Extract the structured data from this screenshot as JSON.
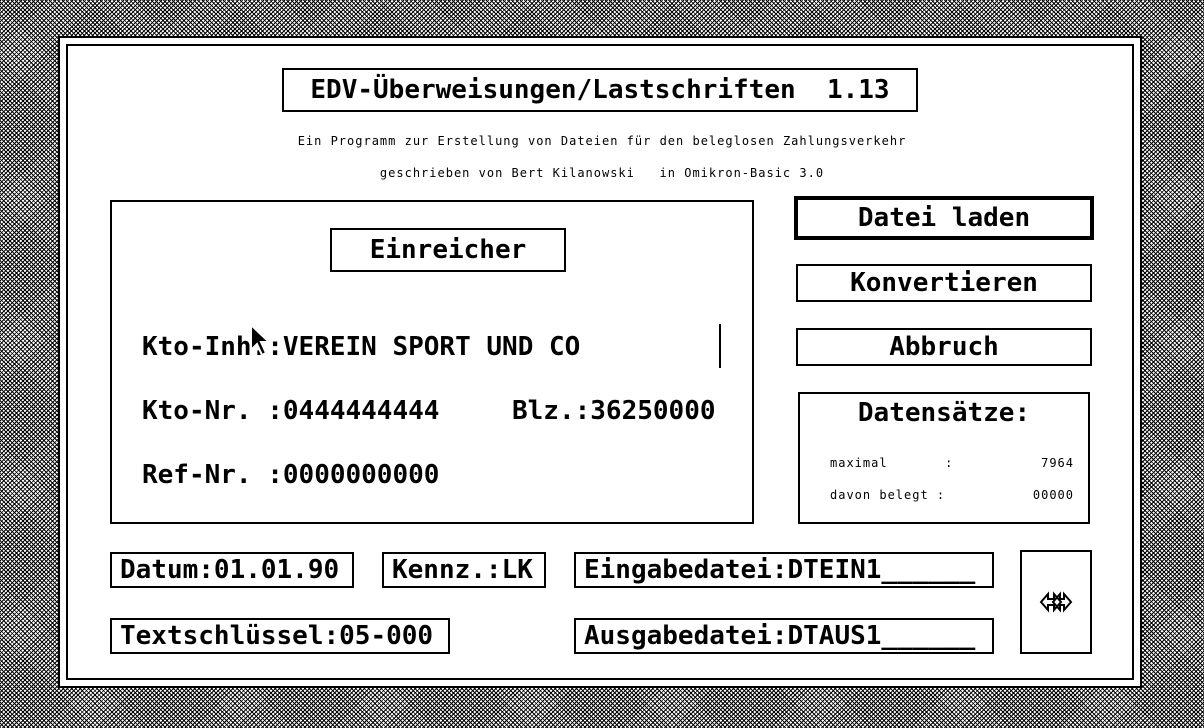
{
  "title": "EDV-Überweisungen/Lastschriften  1.13",
  "subtitle1": "Ein Programm zur Erstellung von Dateien für den beleglosen Zahlungsverkehr",
  "subtitle2": "geschrieben von Bert Kilanowski   in Omikron-Basic 3.0",
  "einreicher": {
    "heading": "Einreicher",
    "kto_inh_label": "Kto-Inh.:",
    "kto_inh_value": "VEREIN SPORT UND CO",
    "kto_nr_label": "Kto-Nr. :",
    "kto_nr_value": "0444444444",
    "blz_label": "Blz.:",
    "blz_value": "36250000",
    "ref_nr_label": "Ref-Nr. :",
    "ref_nr_value": "0000000000"
  },
  "buttons": {
    "load": "Datei laden",
    "convert": "Konvertieren",
    "abort": "Abbruch"
  },
  "datensaetze": {
    "heading": "Datensätze:",
    "max_label": "maximal       :",
    "max_value": "7964",
    "used_label": "davon belegt :",
    "used_value": "00000"
  },
  "fields": {
    "datum": "Datum:01.01.90",
    "kennz": "Kennz.:LK",
    "eingabe": "Eingabedatei:DTEIN1______",
    "textschluessel": "Textschlüssel:05-000",
    "ausgabe": "Ausgabedatei:DTAUS1______"
  },
  "icons": {
    "swap": "double-arrow-icon",
    "cursor": "mouse-pointer-icon"
  }
}
